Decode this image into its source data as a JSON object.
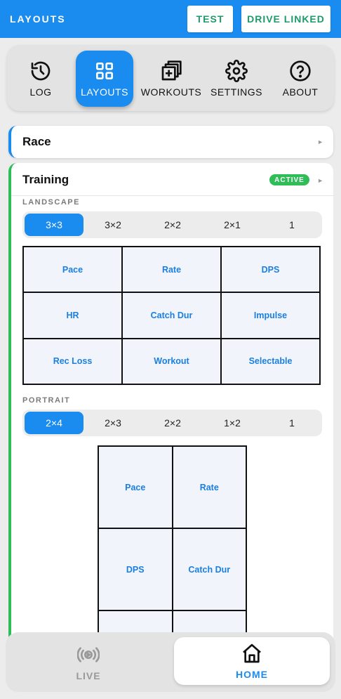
{
  "header": {
    "title": "LAYOUTS",
    "test_label": "TEST",
    "drive_label": "DRIVE LINKED",
    "accent": "#1a8cf0",
    "button_text_color": "#1f9a6b"
  },
  "nav": {
    "items": [
      {
        "label": "LOG",
        "icon": "history-icon"
      },
      {
        "label": "LAYOUTS",
        "icon": "grid-icon",
        "active": true
      },
      {
        "label": "WORKOUTS",
        "icon": "stacked-plus-icon"
      },
      {
        "label": "SETTINGS",
        "icon": "gear-icon"
      },
      {
        "label": "ABOUT",
        "icon": "help-circle-icon"
      }
    ]
  },
  "race": {
    "label": "Race"
  },
  "training": {
    "label": "Training",
    "badge": "ACTIVE",
    "landscape": {
      "label": "LANDSCAPE",
      "options": [
        "3×3",
        "3×2",
        "2×2",
        "2×1",
        "1"
      ],
      "selected": "3×3",
      "cells": [
        "Pace",
        "Rate",
        "DPS",
        "HR",
        "Catch Dur",
        "Impulse",
        "Rec Loss",
        "Workout",
        "Selectable"
      ]
    },
    "portrait": {
      "label": "PORTRAIT",
      "options": [
        "2×4",
        "2×3",
        "2×2",
        "1×2",
        "1"
      ],
      "selected": "2×4",
      "cells": [
        "Pace",
        "Rate",
        "DPS",
        "Catch Dur"
      ]
    }
  },
  "bottom_nav": {
    "live_label": "LIVE",
    "home_label": "HOME",
    "active": "HOME"
  }
}
